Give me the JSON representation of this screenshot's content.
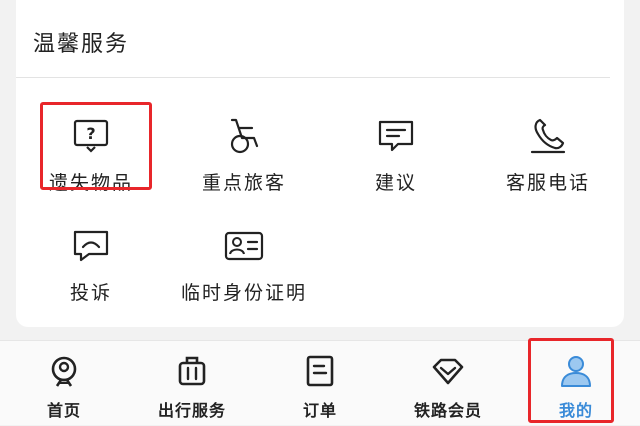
{
  "section": {
    "title": "温馨服务",
    "items": [
      {
        "label": "遗失物品",
        "icon": "lost-item-icon"
      },
      {
        "label": "重点旅客",
        "icon": "wheelchair-icon"
      },
      {
        "label": "建议",
        "icon": "suggestion-icon"
      },
      {
        "label": "客服电话",
        "icon": "phone-icon"
      },
      {
        "label": "投诉",
        "icon": "complaint-icon"
      },
      {
        "label": "临时身份证明",
        "icon": "id-card-icon"
      }
    ]
  },
  "tabbar": {
    "tabs": [
      {
        "label": "首页",
        "icon": "home-train-icon"
      },
      {
        "label": "出行服务",
        "icon": "luggage-icon"
      },
      {
        "label": "订单",
        "icon": "order-icon"
      },
      {
        "label": "铁路会员",
        "icon": "diamond-icon"
      },
      {
        "label": "我的",
        "icon": "user-icon",
        "active": true
      }
    ]
  },
  "colors": {
    "highlight": "#e8262a",
    "active_tab": "#3a8bd8",
    "text": "#222222"
  }
}
